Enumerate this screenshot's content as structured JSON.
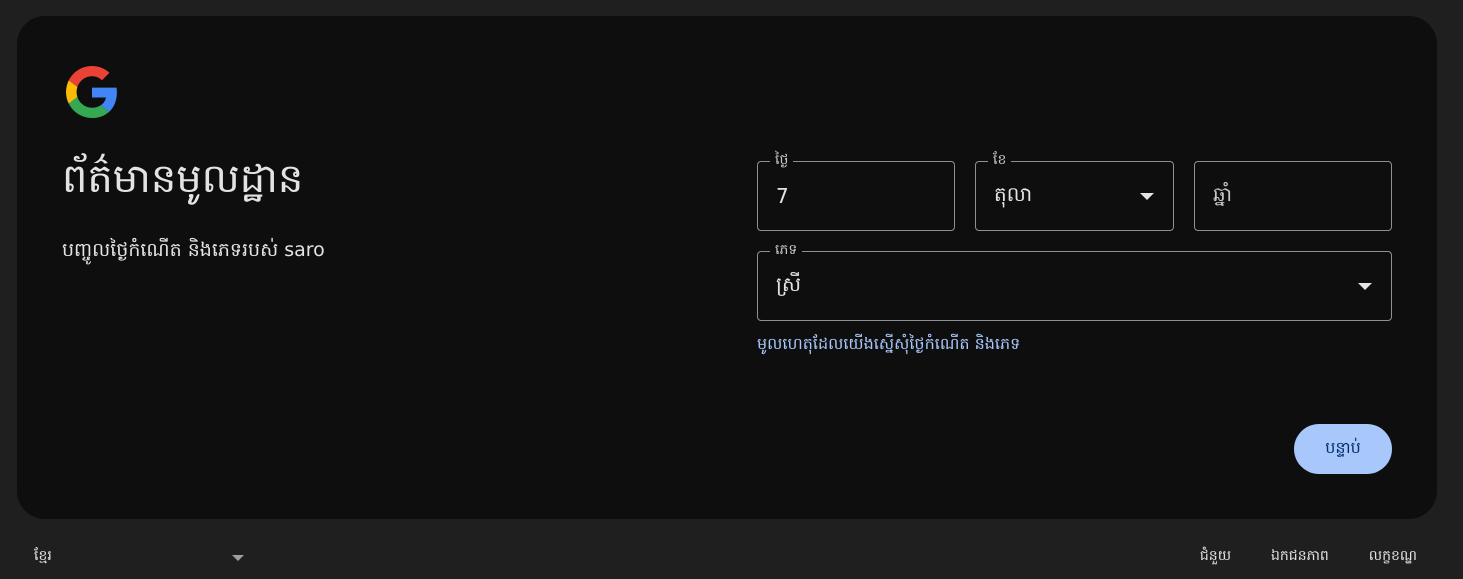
{
  "header": {
    "logo_icon": "google-g-logo",
    "title": "ព័ត៌មានមូលដ្ឋាន",
    "subtitle": "បញ្ចូលថ្ងៃកំណើត និងភេទរបស់ saro"
  },
  "form": {
    "day": {
      "label": "ថ្ងៃ",
      "value": "7"
    },
    "month": {
      "label": "ខែ",
      "value": "តុលា"
    },
    "year": {
      "placeholder": "ឆ្នាំ",
      "value": ""
    },
    "gender": {
      "label": "ភេទ",
      "value": "ស្រី"
    },
    "why_link": "មូលហេតុដែលយើងស្នើសុំថ្ងៃកំណើត និងភេទ",
    "next_button": "បន្ទាប់"
  },
  "footer": {
    "language": "ខ្មែរ",
    "links": [
      "ជំនួយ",
      "ឯកជនភាព",
      "លក្ខខណ្ឌ"
    ]
  },
  "colors": {
    "page_background": "#1f1f1f",
    "card_background": "#0e0e0f",
    "accent": "#a8c7fa",
    "button_text": "#062e6f",
    "outline": "#8e918f"
  }
}
